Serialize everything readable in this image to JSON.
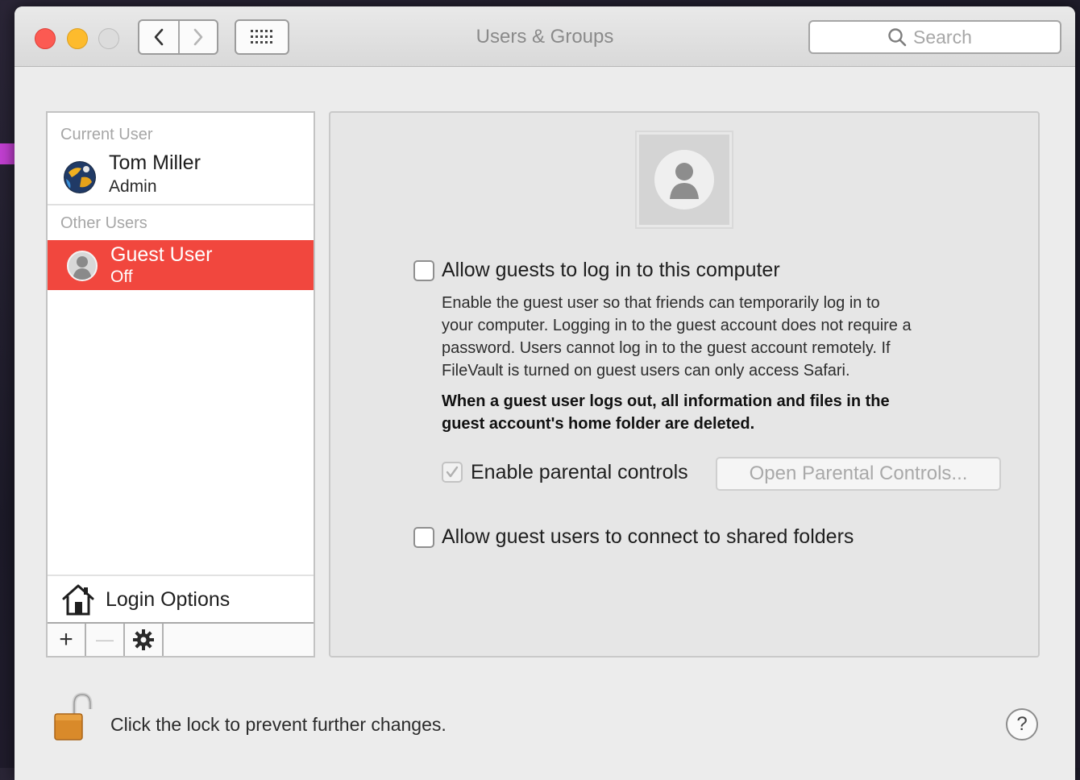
{
  "window": {
    "title": "Users & Groups"
  },
  "toolbar": {
    "back_icon": "chevron-left",
    "forward_icon": "chevron-right",
    "show_all_icon": "grid"
  },
  "search": {
    "placeholder": "Search"
  },
  "sidebar": {
    "current_section_label": "Current User",
    "current_user": {
      "name": "Tom Miller",
      "role": "Admin"
    },
    "other_section_label": "Other Users",
    "other_users": [
      {
        "name": "Guest User",
        "status": "Off",
        "selected": true
      }
    ],
    "login_options_label": "Login Options",
    "add_label": "+",
    "remove_label": "—"
  },
  "panel": {
    "allow_guests": {
      "label": "Allow guests to log in to this computer",
      "checked": false
    },
    "description_lines": [
      "Enable the guest user so that friends can temporarily log in to",
      "your computer. Logging in to the guest account does not require a",
      "password. Users cannot log in to the guest account remotely. If",
      "FileVault is turned on guest users can only access Safari."
    ],
    "warning_lines": [
      "When a guest user logs out, all information and files in the",
      "guest account's home folder are deleted."
    ],
    "parental": {
      "label": "Enable parental controls",
      "checked": true,
      "disabled": true,
      "open_button": "Open Parental Controls..."
    },
    "shared_folders": {
      "label": "Allow guest users to connect to shared folders",
      "checked": false
    }
  },
  "footer": {
    "lock_text": "Click the lock to prevent further changes.",
    "help_label": "?"
  },
  "colors": {
    "selection": "#f1473e",
    "close": "#fc5a52",
    "minimize": "#fdbb2d"
  }
}
